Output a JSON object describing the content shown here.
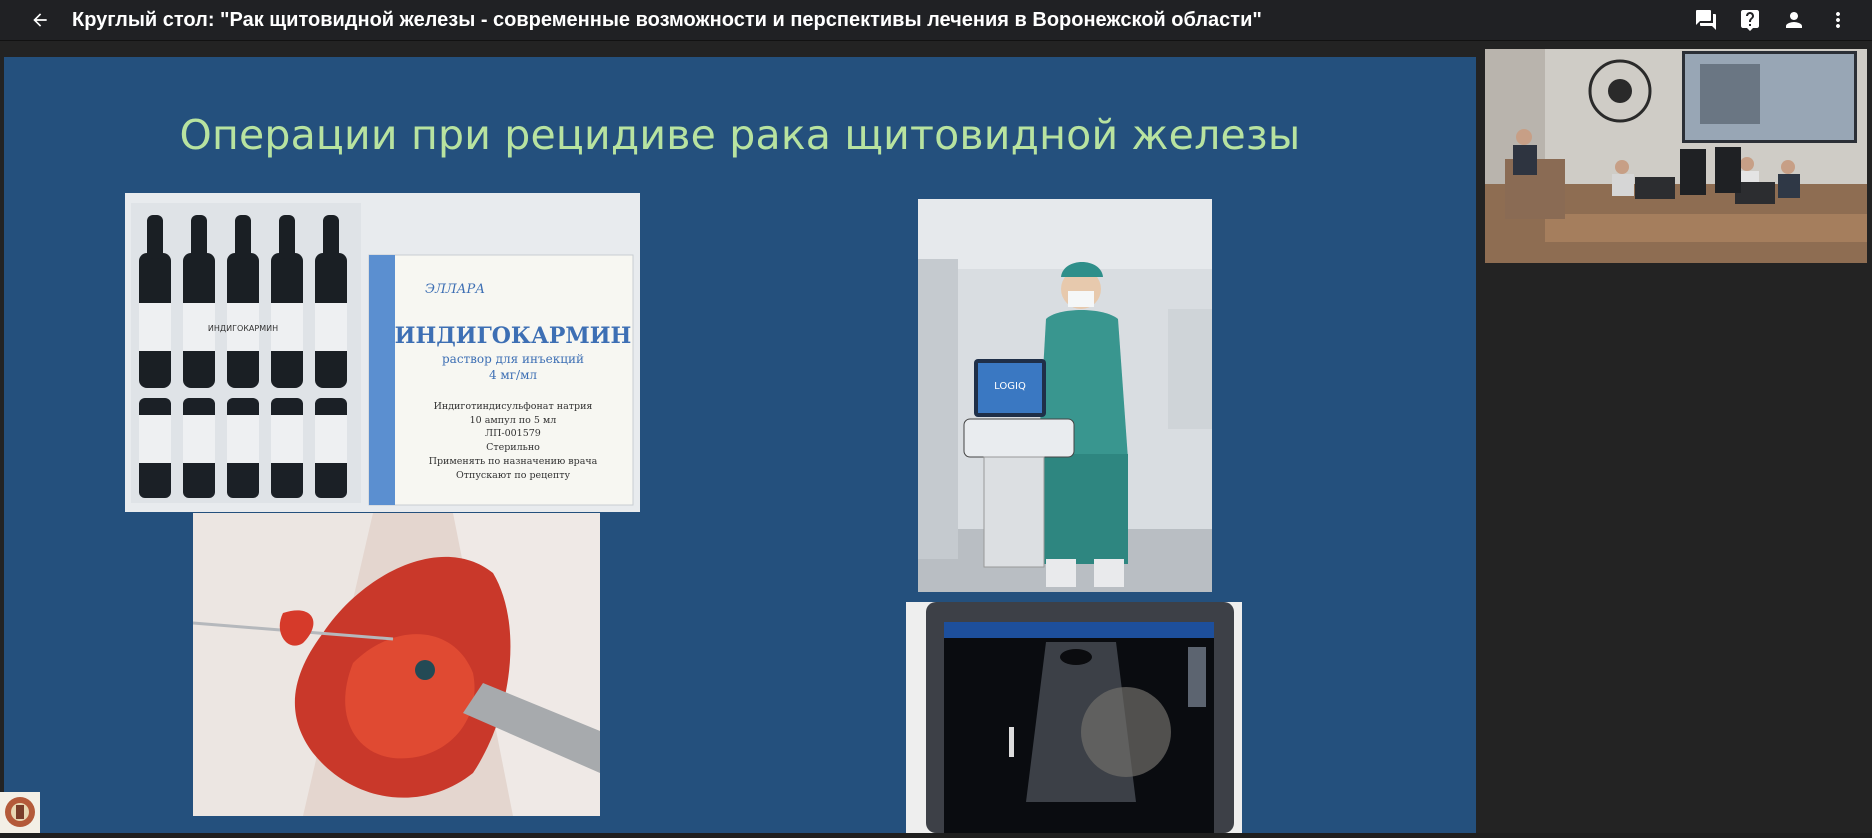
{
  "header": {
    "title": "Круглый стол: \"Рак щитовидной железы - современные возможности и перспективы лечения в Воронежской области\"",
    "back_icon": "arrow-left-icon",
    "actions": [
      {
        "name": "chat-icon"
      },
      {
        "name": "help-icon"
      },
      {
        "name": "person-icon"
      },
      {
        "name": "more-vert-icon"
      }
    ]
  },
  "slide": {
    "title": "Операции при рецидиве рака щитовидной железы",
    "background": "#24507d",
    "title_color": "#b8e3a0",
    "ampoule_box": {
      "brand": "ЭЛЛАРА",
      "name": "ИНДИГОКАРМИН",
      "subtitle": "раствор для инъекций",
      "dose": "4 мг/мл",
      "line1": "Индиготиндисульфонат натрия",
      "line2": "10 ампул по 5 мл",
      "line3": "ЛП-001579",
      "line4": "Стерильно",
      "line5": "Применять по назначению врача",
      "line6": "Отпускают по рецепту",
      "ampoule_label": "ИНДИГОКАРМИН"
    },
    "ultrasound_device": {
      "brand_logo": "LOGIQ"
    }
  }
}
